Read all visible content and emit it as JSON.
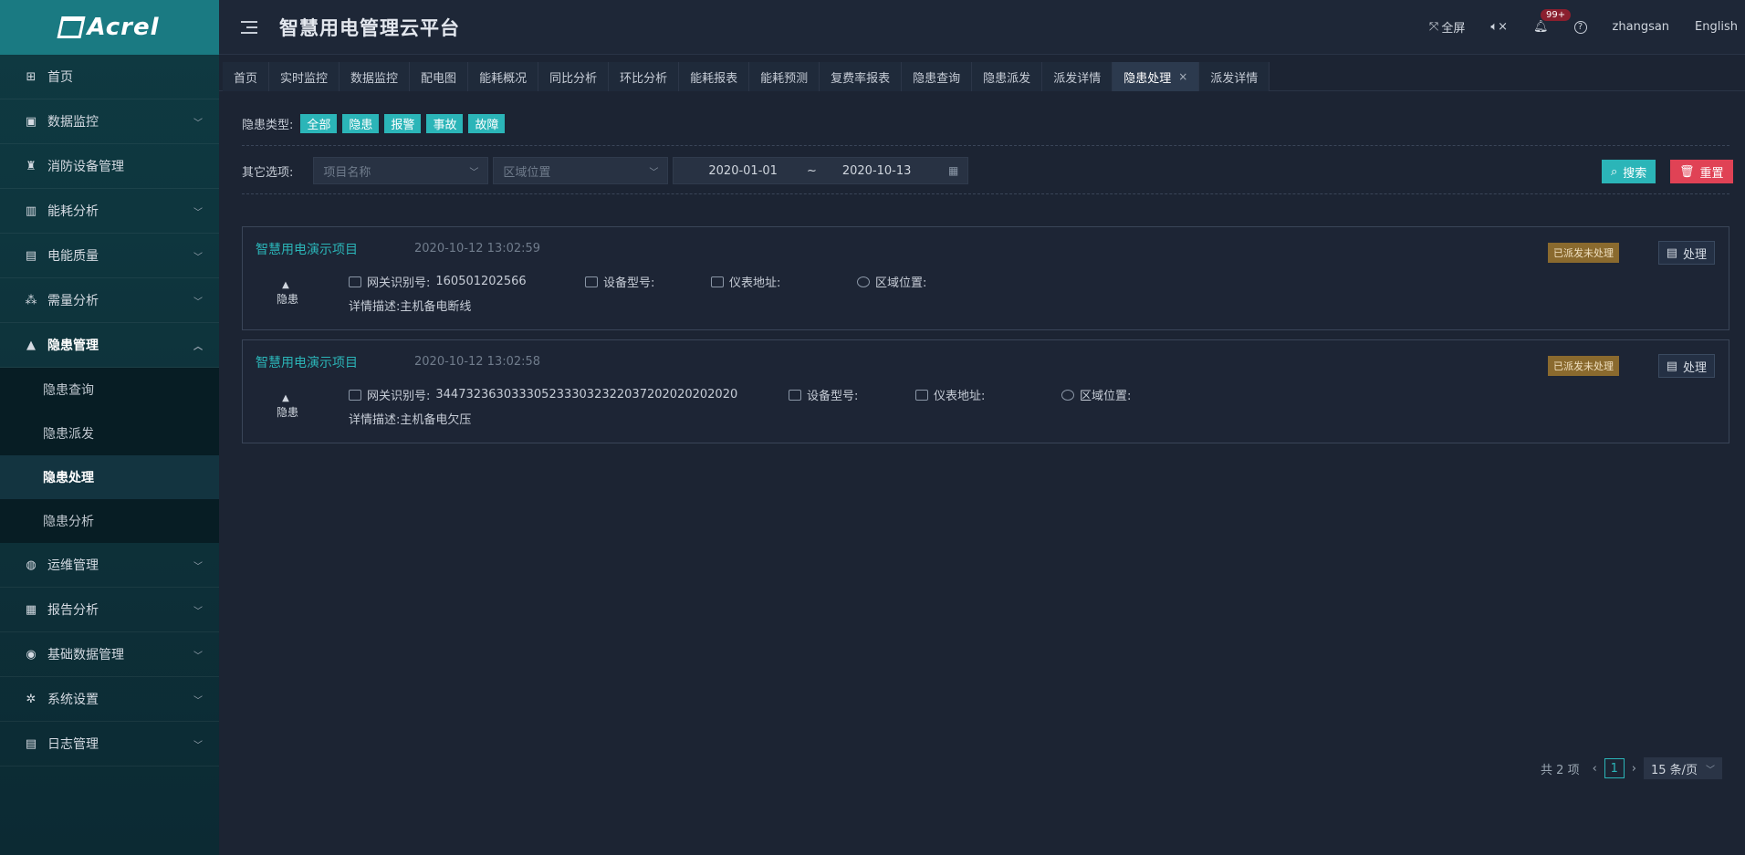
{
  "app": {
    "logo_text": "Acrel",
    "title": "智慧用电管理云平台",
    "fullscreen_label": "全屏",
    "notification_count": "99+",
    "username": "zhangsan",
    "language": "English"
  },
  "sidebar": {
    "items": [
      {
        "label": "首页",
        "icon": "home-icon",
        "chevron": ""
      },
      {
        "label": "数据监控",
        "icon": "monitor-icon",
        "chevron": "⌄"
      },
      {
        "label": "消防设备管理",
        "icon": "fire-extinguisher-icon",
        "chevron": ""
      },
      {
        "label": "能耗分析",
        "icon": "bar-chart-icon",
        "chevron": "⌄"
      },
      {
        "label": "电能质量",
        "icon": "battery-icon",
        "chevron": "⌄"
      },
      {
        "label": "需量分析",
        "icon": "nodes-icon",
        "chevron": "⌄"
      },
      {
        "label": "隐患管理",
        "icon": "warning-icon",
        "chevron": "⌃"
      }
    ],
    "submenu": [
      {
        "label": "隐患查询"
      },
      {
        "label": "隐患派发"
      },
      {
        "label": "隐患处理"
      },
      {
        "label": "隐患分析"
      }
    ],
    "items_after": [
      {
        "label": "运维管理",
        "icon": "globe-icon",
        "chevron": "⌄"
      },
      {
        "label": "报告分析",
        "icon": "report-icon",
        "chevron": "⌄"
      },
      {
        "label": "基础数据管理",
        "icon": "database-icon",
        "chevron": "⌄"
      },
      {
        "label": "系统设置",
        "icon": "settings-icon",
        "chevron": "⌄"
      },
      {
        "label": "日志管理",
        "icon": "log-icon",
        "chevron": "⌄"
      }
    ]
  },
  "tabs": [
    {
      "label": "首页"
    },
    {
      "label": "实时监控"
    },
    {
      "label": "数据监控"
    },
    {
      "label": "配电图"
    },
    {
      "label": "能耗概况"
    },
    {
      "label": "同比分析"
    },
    {
      "label": "环比分析"
    },
    {
      "label": "能耗报表"
    },
    {
      "label": "能耗预测"
    },
    {
      "label": "复费率报表"
    },
    {
      "label": "隐患查询"
    },
    {
      "label": "隐患派发"
    },
    {
      "label": "派发详情"
    },
    {
      "label": "隐患处理"
    },
    {
      "label": "派发详情"
    }
  ],
  "filters": {
    "type_label": "隐患类型:",
    "types": [
      "全部",
      "隐患",
      "报警",
      "事故",
      "故障"
    ],
    "other_label": "其它选项:",
    "project_placeholder": "项目名称",
    "area_placeholder": "区域位置",
    "date_start": "2020-01-01",
    "date_sep": "~",
    "date_end": "2020-10-13",
    "search_label": "搜索",
    "reset_label": "重置"
  },
  "records": [
    {
      "project": "智慧用电演示项目",
      "time": "2020-10-12 13:02:59",
      "kind": "隐患",
      "gateway_label": "网关识别号:",
      "gateway_value": "160501202566",
      "device_label": "设备型号:",
      "meter_label": "仪表地址:",
      "area_label": "区域位置:",
      "desc": "详情描述:主机备电断线",
      "status": "已派发未处理",
      "action": "处理"
    },
    {
      "project": "智慧用电演示项目",
      "time": "2020-10-12 13:02:58",
      "kind": "隐患",
      "gateway_label": "网关识别号:",
      "gateway_value": "3447323630333052333032322037202020202020",
      "device_label": "设备型号:",
      "meter_label": "仪表地址:",
      "area_label": "区域位置:",
      "desc": "详情描述:主机备电欠压",
      "status": "已派发未处理",
      "action": "处理"
    }
  ],
  "pagination": {
    "total": "共 2 项",
    "current_page": "1",
    "page_size": "15 条/页"
  }
}
